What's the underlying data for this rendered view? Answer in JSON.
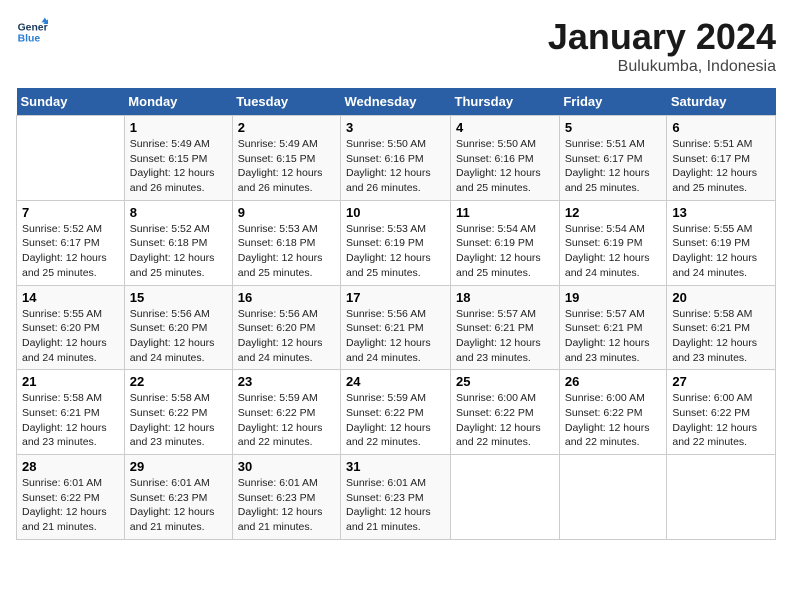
{
  "header": {
    "logo_line1": "General",
    "logo_line2": "Blue",
    "month_title": "January 2024",
    "subtitle": "Bulukumba, Indonesia"
  },
  "days_of_week": [
    "Sunday",
    "Monday",
    "Tuesday",
    "Wednesday",
    "Thursday",
    "Friday",
    "Saturday"
  ],
  "weeks": [
    [
      {
        "day": "",
        "info": ""
      },
      {
        "day": "1",
        "info": "Sunrise: 5:49 AM\nSunset: 6:15 PM\nDaylight: 12 hours\nand 26 minutes."
      },
      {
        "day": "2",
        "info": "Sunrise: 5:49 AM\nSunset: 6:15 PM\nDaylight: 12 hours\nand 26 minutes."
      },
      {
        "day": "3",
        "info": "Sunrise: 5:50 AM\nSunset: 6:16 PM\nDaylight: 12 hours\nand 26 minutes."
      },
      {
        "day": "4",
        "info": "Sunrise: 5:50 AM\nSunset: 6:16 PM\nDaylight: 12 hours\nand 25 minutes."
      },
      {
        "day": "5",
        "info": "Sunrise: 5:51 AM\nSunset: 6:17 PM\nDaylight: 12 hours\nand 25 minutes."
      },
      {
        "day": "6",
        "info": "Sunrise: 5:51 AM\nSunset: 6:17 PM\nDaylight: 12 hours\nand 25 minutes."
      }
    ],
    [
      {
        "day": "7",
        "info": "Sunrise: 5:52 AM\nSunset: 6:17 PM\nDaylight: 12 hours\nand 25 minutes."
      },
      {
        "day": "8",
        "info": "Sunrise: 5:52 AM\nSunset: 6:18 PM\nDaylight: 12 hours\nand 25 minutes."
      },
      {
        "day": "9",
        "info": "Sunrise: 5:53 AM\nSunset: 6:18 PM\nDaylight: 12 hours\nand 25 minutes."
      },
      {
        "day": "10",
        "info": "Sunrise: 5:53 AM\nSunset: 6:19 PM\nDaylight: 12 hours\nand 25 minutes."
      },
      {
        "day": "11",
        "info": "Sunrise: 5:54 AM\nSunset: 6:19 PM\nDaylight: 12 hours\nand 25 minutes."
      },
      {
        "day": "12",
        "info": "Sunrise: 5:54 AM\nSunset: 6:19 PM\nDaylight: 12 hours\nand 24 minutes."
      },
      {
        "day": "13",
        "info": "Sunrise: 5:55 AM\nSunset: 6:19 PM\nDaylight: 12 hours\nand 24 minutes."
      }
    ],
    [
      {
        "day": "14",
        "info": "Sunrise: 5:55 AM\nSunset: 6:20 PM\nDaylight: 12 hours\nand 24 minutes."
      },
      {
        "day": "15",
        "info": "Sunrise: 5:56 AM\nSunset: 6:20 PM\nDaylight: 12 hours\nand 24 minutes."
      },
      {
        "day": "16",
        "info": "Sunrise: 5:56 AM\nSunset: 6:20 PM\nDaylight: 12 hours\nand 24 minutes."
      },
      {
        "day": "17",
        "info": "Sunrise: 5:56 AM\nSunset: 6:21 PM\nDaylight: 12 hours\nand 24 minutes."
      },
      {
        "day": "18",
        "info": "Sunrise: 5:57 AM\nSunset: 6:21 PM\nDaylight: 12 hours\nand 23 minutes."
      },
      {
        "day": "19",
        "info": "Sunrise: 5:57 AM\nSunset: 6:21 PM\nDaylight: 12 hours\nand 23 minutes."
      },
      {
        "day": "20",
        "info": "Sunrise: 5:58 AM\nSunset: 6:21 PM\nDaylight: 12 hours\nand 23 minutes."
      }
    ],
    [
      {
        "day": "21",
        "info": "Sunrise: 5:58 AM\nSunset: 6:21 PM\nDaylight: 12 hours\nand 23 minutes."
      },
      {
        "day": "22",
        "info": "Sunrise: 5:58 AM\nSunset: 6:22 PM\nDaylight: 12 hours\nand 23 minutes."
      },
      {
        "day": "23",
        "info": "Sunrise: 5:59 AM\nSunset: 6:22 PM\nDaylight: 12 hours\nand 22 minutes."
      },
      {
        "day": "24",
        "info": "Sunrise: 5:59 AM\nSunset: 6:22 PM\nDaylight: 12 hours\nand 22 minutes."
      },
      {
        "day": "25",
        "info": "Sunrise: 6:00 AM\nSunset: 6:22 PM\nDaylight: 12 hours\nand 22 minutes."
      },
      {
        "day": "26",
        "info": "Sunrise: 6:00 AM\nSunset: 6:22 PM\nDaylight: 12 hours\nand 22 minutes."
      },
      {
        "day": "27",
        "info": "Sunrise: 6:00 AM\nSunset: 6:22 PM\nDaylight: 12 hours\nand 22 minutes."
      }
    ],
    [
      {
        "day": "28",
        "info": "Sunrise: 6:01 AM\nSunset: 6:22 PM\nDaylight: 12 hours\nand 21 minutes."
      },
      {
        "day": "29",
        "info": "Sunrise: 6:01 AM\nSunset: 6:23 PM\nDaylight: 12 hours\nand 21 minutes."
      },
      {
        "day": "30",
        "info": "Sunrise: 6:01 AM\nSunset: 6:23 PM\nDaylight: 12 hours\nand 21 minutes."
      },
      {
        "day": "31",
        "info": "Sunrise: 6:01 AM\nSunset: 6:23 PM\nDaylight: 12 hours\nand 21 minutes."
      },
      {
        "day": "",
        "info": ""
      },
      {
        "day": "",
        "info": ""
      },
      {
        "day": "",
        "info": ""
      }
    ]
  ]
}
